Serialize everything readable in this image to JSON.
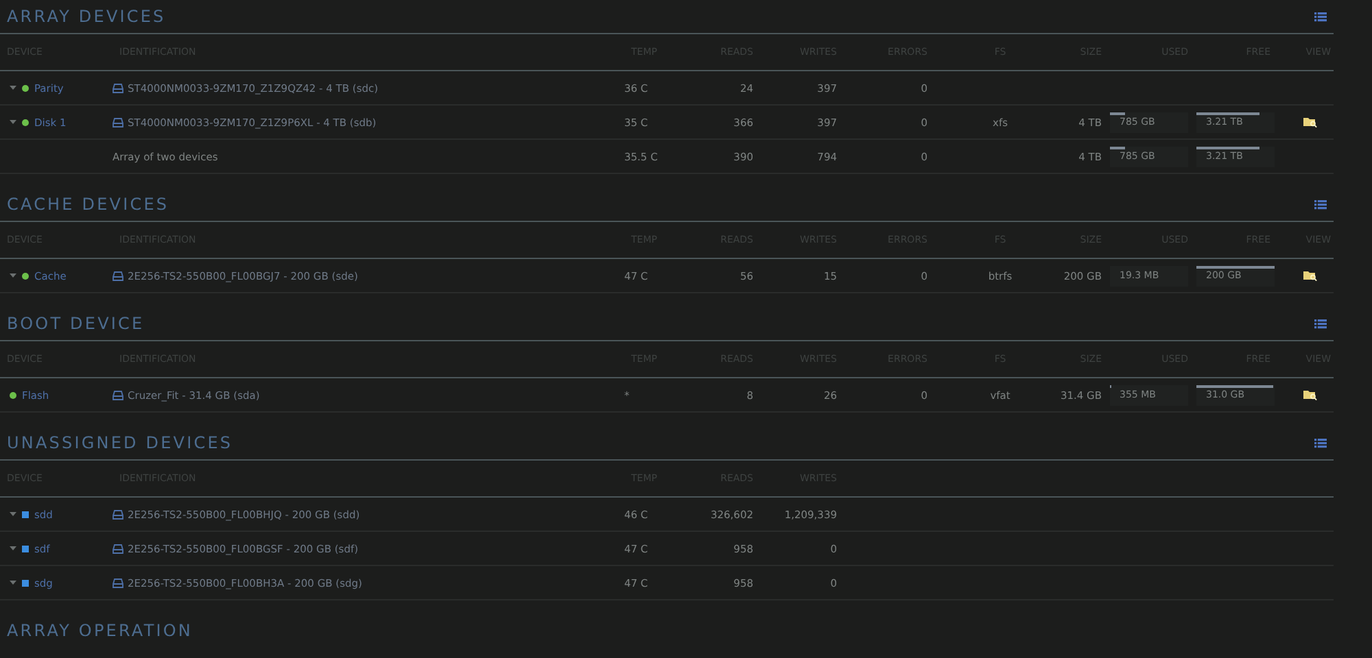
{
  "sections": [
    {
      "title": "ARRAY DEVICES",
      "columns": [
        "DEVICE",
        "IDENTIFICATION",
        "TEMP",
        "READS",
        "WRITES",
        "ERRORS",
        "FS",
        "SIZE",
        "USED",
        "FREE",
        "VIEW"
      ],
      "rows": [
        {
          "kind": "array_device",
          "expandable": true,
          "color": "#6cc04a",
          "device": "Parity",
          "identification": "ST4000NM0033-9ZM170_Z1Z9QZ42 - 4 TB (sdc)",
          "temp": "36 C",
          "reads": "24",
          "writes": "397",
          "errors": "0"
        },
        {
          "kind": "array_device",
          "expandable": true,
          "color": "#6cc04a",
          "device": "Disk 1",
          "identification": "ST4000NM0033-9ZM170_Z1Z9P6XL - 4 TB (sdb)",
          "temp": "35 C",
          "reads": "366",
          "writes": "397",
          "errors": "0",
          "fs": "xfs",
          "size": "4 TB",
          "used": {
            "text": "785 GB",
            "level": 0.2
          },
          "free": {
            "text": "3.21 TB",
            "level": 0.8
          },
          "view": true
        },
        {
          "kind": "summary",
          "identification": "Array of two devices",
          "temp": "35.5 C",
          "reads": "390",
          "writes": "794",
          "errors": "0",
          "size": "4 TB",
          "used": {
            "text": "785 GB",
            "level": 0.2
          },
          "free": {
            "text": "3.21 TB",
            "level": 0.8
          }
        }
      ]
    },
    {
      "title": "CACHE DEVICES",
      "columns": [
        "DEVICE",
        "IDENTIFICATION",
        "TEMP",
        "READS",
        "WRITES",
        "ERRORS",
        "FS",
        "SIZE",
        "USED",
        "FREE",
        "VIEW"
      ],
      "rows": [
        {
          "kind": "array_device",
          "expandable": true,
          "color": "#6cc04a",
          "device": "Cache",
          "identification": "2E256-TS2-550B00_FL00BGJ7 - 200 GB (sde)",
          "temp": "47 C",
          "reads": "56",
          "writes": "15",
          "errors": "0",
          "fs": "btrfs",
          "size": "200 GB",
          "used": {
            "text": "19.3 MB"
          },
          "free": {
            "text": "200 GB",
            "level": 1
          },
          "view": true
        }
      ]
    },
    {
      "title": "BOOT DEVICE",
      "columns": [
        "DEVICE",
        "IDENTIFICATION",
        "TEMP",
        "READS",
        "WRITES",
        "ERRORS",
        "FS",
        "SIZE",
        "USED",
        "FREE",
        "VIEW"
      ],
      "rows": [
        {
          "kind": "array_device",
          "expandable": false,
          "color": "#6cc04a",
          "device": "Flash",
          "identification": "Cruzer_Fit - 31.4 GB (sda)",
          "temp": "*",
          "reads": "8",
          "writes": "26",
          "errors": "0",
          "fs": "vfat",
          "size": "31.4 GB",
          "used": {
            "text": "355 MB",
            "level": 0.02
          },
          "free": {
            "text": "31.0 GB",
            "level": 0.98
          },
          "view": true
        }
      ]
    },
    {
      "title": "UNASSIGNED DEVICES",
      "columns": [
        "DEVICE",
        "IDENTIFICATION",
        "TEMP",
        "READS",
        "WRITES"
      ],
      "rows": [
        {
          "kind": "unassigned_device",
          "expandable": true,
          "color": "#3b8de0",
          "device": "sdd",
          "identification": "2E256-TS2-550B00_FL00BHJQ - 200 GB (sdd)",
          "temp": "46 C",
          "reads": "326,602",
          "writes": "1,209,339"
        },
        {
          "kind": "unassigned_device",
          "expandable": true,
          "color": "#3b8de0",
          "device": "sdf",
          "identification": "2E256-TS2-550B00_FL00BGSF - 200 GB (sdf)",
          "temp": "47 C",
          "reads": "958",
          "writes": "0"
        },
        {
          "kind": "unassigned_device",
          "expandable": true,
          "color": "#3b8de0",
          "device": "sdg",
          "identification": "2E256-TS2-550B00_FL00BH3A - 200 GB (sdg)",
          "temp": "47 C",
          "reads": "958",
          "writes": "0"
        }
      ]
    }
  ],
  "next_section_title": "ARRAY OPERATION"
}
